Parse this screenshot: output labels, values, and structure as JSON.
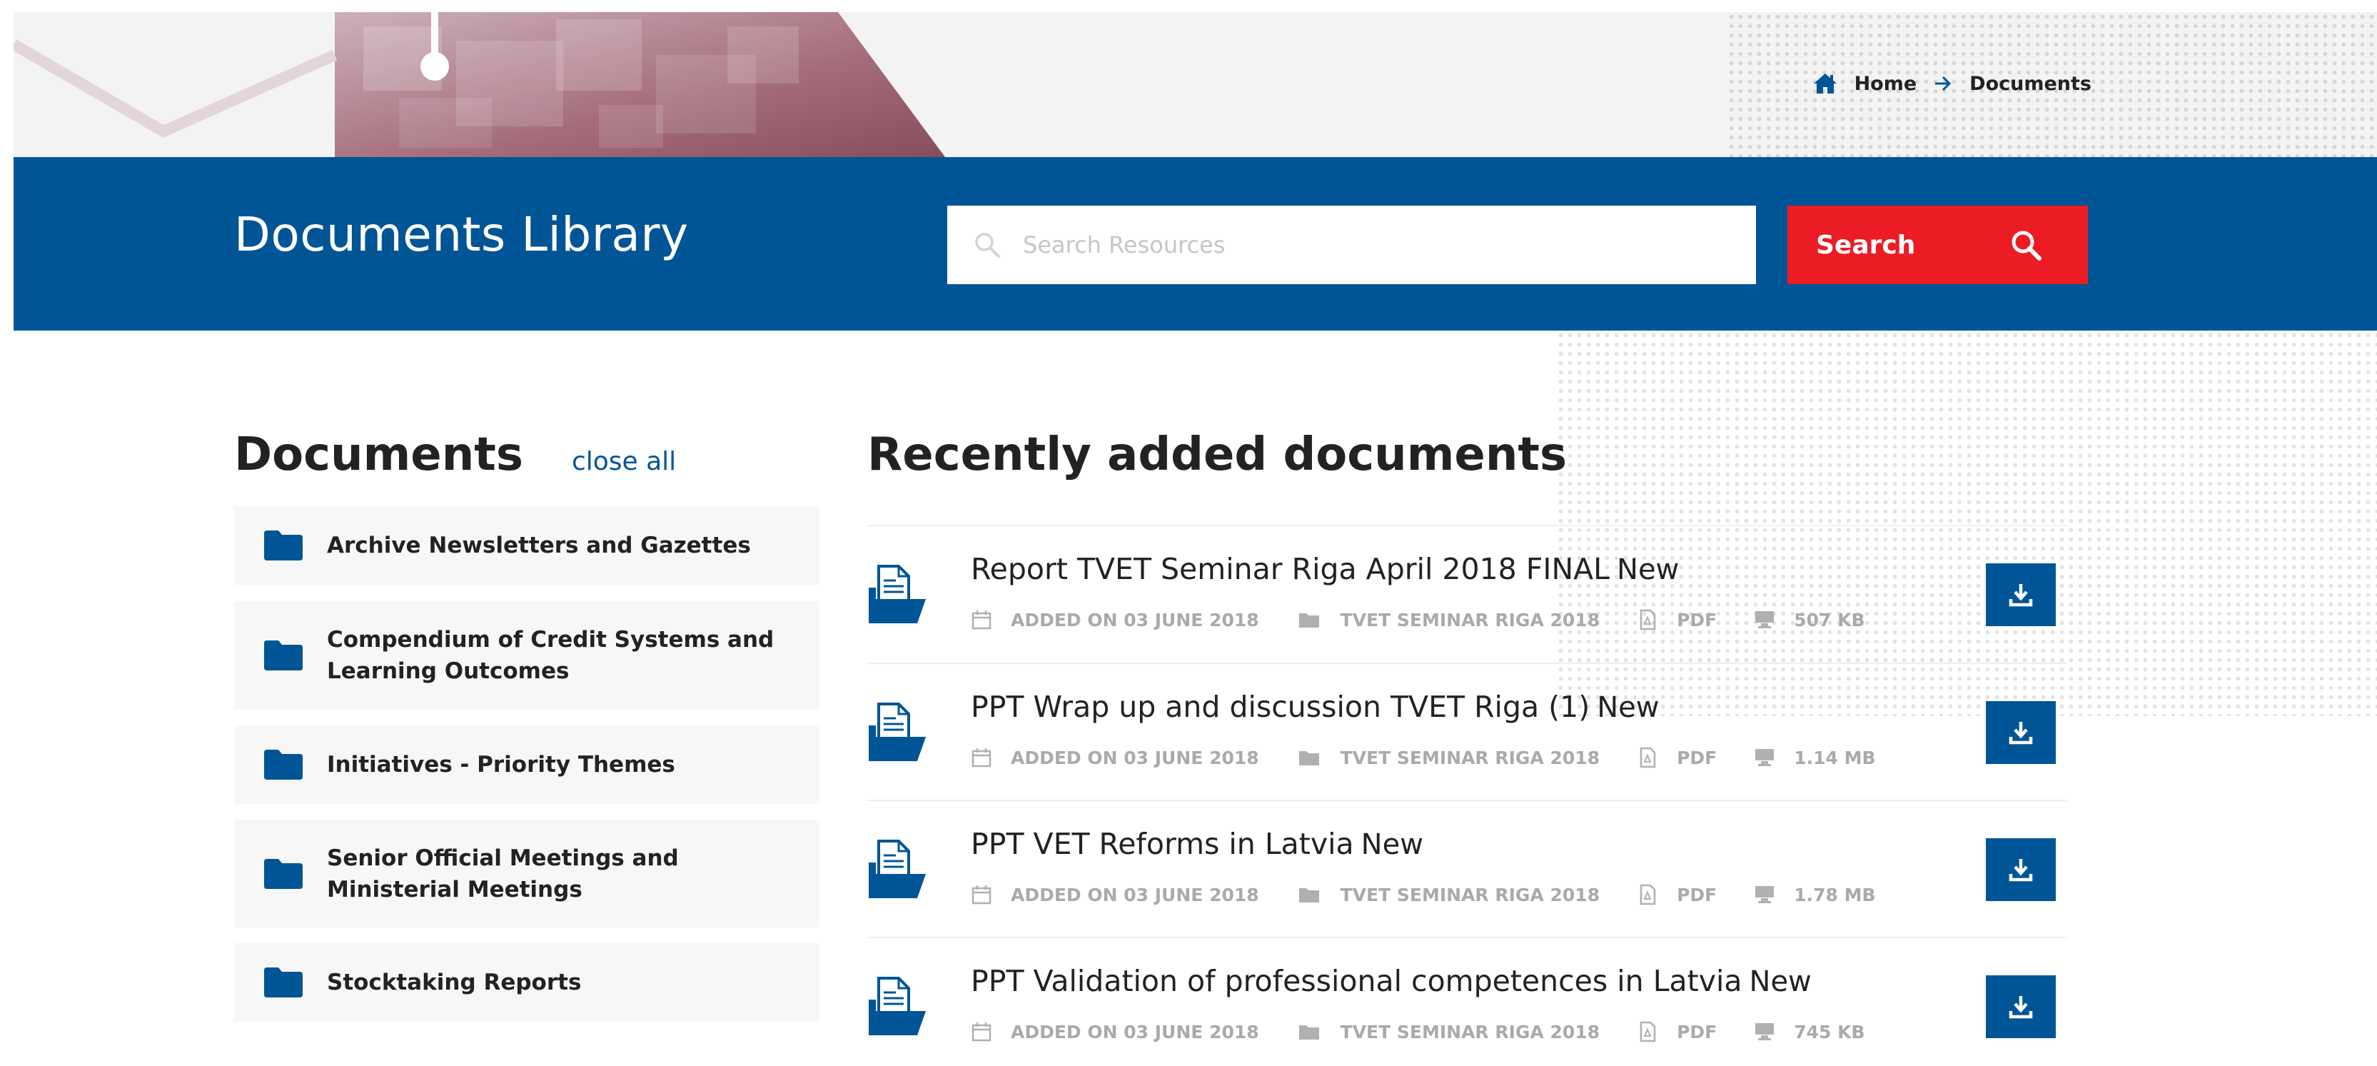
{
  "breadcrumb": {
    "home_label": "Home",
    "current_label": "Documents"
  },
  "header": {
    "title": "Documents Library",
    "search_placeholder": "Search Resources",
    "search_button_label": "Search"
  },
  "sidebar": {
    "title": "Documents",
    "close_all_label": "close all",
    "folders": [
      {
        "label": "Archive Newsletters and Gazettes"
      },
      {
        "label": "Compendium of Credit Systems and Learning Outcomes"
      },
      {
        "label": "Initiatives - Priority Themes"
      },
      {
        "label": "Senior Official Meetings and Ministerial Meetings"
      },
      {
        "label": "Stocktaking Reports"
      }
    ]
  },
  "recent": {
    "title": "Recently added documents",
    "new_label": "New",
    "documents": [
      {
        "title": "Report TVET Seminar Riga April 2018 FINAL",
        "added": "ADDED ON 03 JUNE 2018",
        "category": "TVET SEMINAR RIGA 2018",
        "format": "PDF",
        "size": "507 KB"
      },
      {
        "title": "PPT Wrap up and discussion TVET Riga (1)",
        "added": "ADDED ON 03 JUNE 2018",
        "category": "TVET SEMINAR RIGA 2018",
        "format": "PDF",
        "size": "1.14 MB"
      },
      {
        "title": "PPT VET Reforms in Latvia",
        "added": "ADDED ON 03 JUNE 2018",
        "category": "TVET SEMINAR RIGA 2018",
        "format": "PDF",
        "size": "1.78 MB"
      },
      {
        "title": "PPT Validation of professional competences in Latvia",
        "added": "ADDED ON 03 JUNE 2018",
        "category": "TVET SEMINAR RIGA 2018",
        "format": "PDF",
        "size": "745 KB"
      }
    ]
  },
  "colors": {
    "brand_blue": "#005596",
    "search_red": "#ec1c24",
    "meta_gray": "#aaaaaa",
    "folder_bg": "#f7f7f7"
  },
  "icons": {
    "breadcrumb": [
      "home-icon",
      "arrow-right-icon"
    ],
    "search": [
      "search-icon"
    ],
    "folder": "folder-icon",
    "document": "document-icon",
    "meta": [
      "calendar-icon",
      "folder-icon",
      "pdf-icon",
      "filesize-icon"
    ],
    "download": "download-icon"
  }
}
